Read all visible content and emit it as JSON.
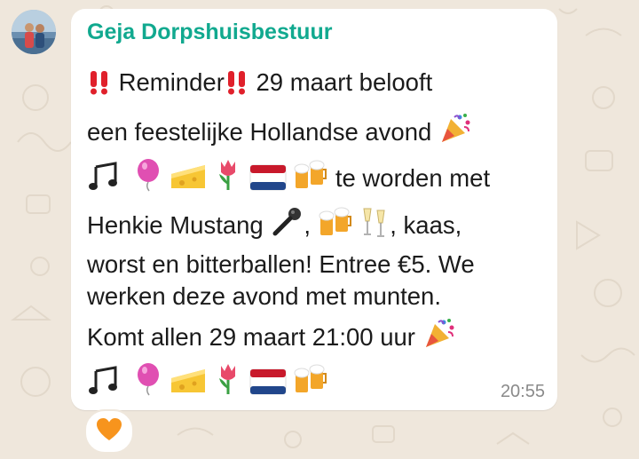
{
  "chat": {
    "sender": "Geja Dorpshuisbestuur",
    "time": "20:55",
    "line1": {
      "a": "Reminder",
      "b": "29 maart belooft"
    },
    "line2": "een feestelijke Hollandse avond",
    "line3": "te worden met",
    "line4": {
      "a": "Henkie Mustang",
      "b": ",",
      "c": ", kaas,"
    },
    "line5": "worst en bitterballen! Entree €5. We",
    "line6": "werken deze avond met munten.",
    "line7": "Komt allen 29 maart 21:00 uur",
    "reaction": "orange-heart-icon",
    "emojis": [
      "double-exclamation-icon",
      "party-popper-icon",
      "music-notes-icon",
      "balloon-icon",
      "cheese-icon",
      "tulip-icon",
      "netherlands-flag-icon",
      "beer-mugs-icon",
      "microphone-icon",
      "champagne-glasses-icon"
    ],
    "colors": {
      "sender": "#11a98f",
      "bubble": "#ffffff",
      "background": "#efe7dc",
      "time": "#8a8a8a"
    }
  }
}
